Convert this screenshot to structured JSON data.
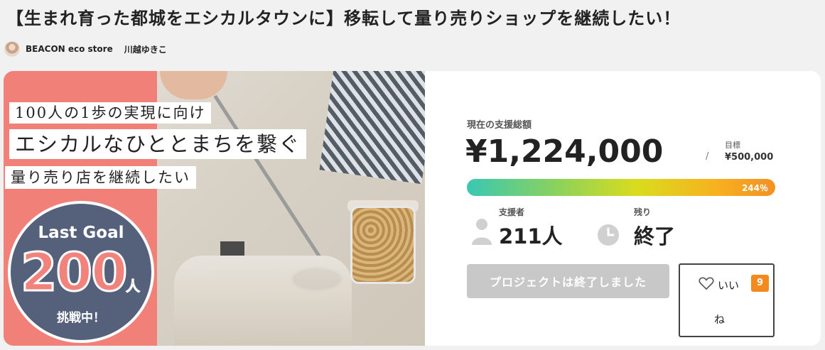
{
  "title": "【生まれ育った都城をエシカルタウンに】移転して量り売りショップを継続したい！",
  "owner": {
    "store": "BEACON eco store",
    "person": "川越ゆきこ"
  },
  "hero": {
    "line1": "100人の1歩の実現に向け",
    "line2": "エシカルなひととまちを繋ぐ",
    "line3": "量り売り店を継続したい",
    "goal_en": "Last Goal",
    "goal_number": "200",
    "goal_unit": "人",
    "goal_challenge": "挑戦中！"
  },
  "stats": {
    "total_label": "現在の支援総額",
    "total_amount": "¥1,224,000",
    "slash": "/",
    "goal_label": "目標",
    "goal_amount": "¥500,000",
    "progress_text": "244％",
    "progress_percent": 244,
    "supporters_label": "支援者",
    "supporters_value": "211人",
    "remaining_label": "残り",
    "remaining_value": "終了"
  },
  "actions": {
    "ended_button": "プロジェクトは終了しました",
    "like_label": "いい",
    "like_label_wrap": "ね",
    "like_count": "9"
  },
  "colors": {
    "hero_pink": "#f08078",
    "goal_circle": "#55607a",
    "like_badge": "#f28a1e",
    "button_disabled": "#c8c8c8"
  }
}
